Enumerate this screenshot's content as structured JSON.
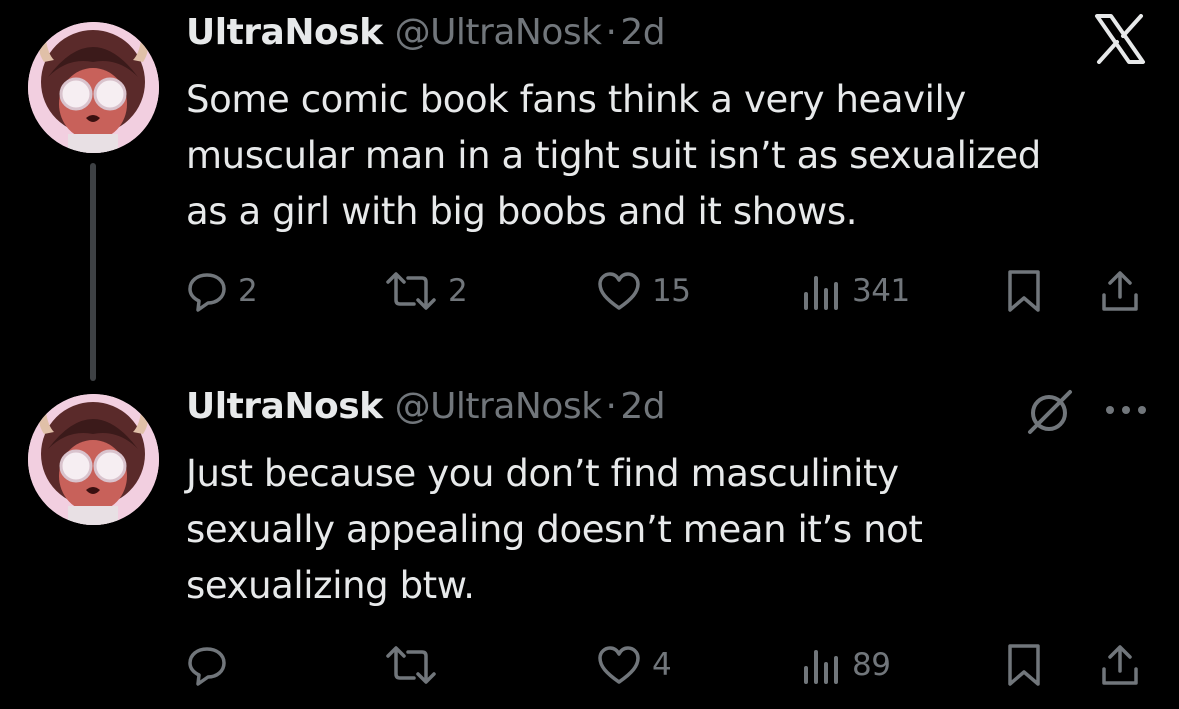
{
  "tweets": [
    {
      "name": "UltraNosk",
      "handle": "@UltraNosk",
      "separator": "·",
      "time": "2d",
      "text_lines": [
        "Some comic book fans think a very heavily",
        "muscular man in a tight suit isn’t as sexualized",
        "as a girl with big boobs and it shows."
      ],
      "replies": "2",
      "reposts": "2",
      "likes": "15",
      "views": "341",
      "corner_icon": "x-logo-icon"
    },
    {
      "name": "UltraNosk",
      "handle": "@UltraNosk",
      "separator": "·",
      "time": "2d",
      "text_lines": [
        "Just because you don’t find masculinity",
        "sexually appealing doesn’t mean it’s not",
        "sexualizing btw."
      ],
      "replies": "",
      "reposts": "",
      "likes": "4",
      "views": "89",
      "corner_icon": "grok-icon"
    }
  ],
  "colors": {
    "background": "#000000",
    "primary_text": "#e7e9ea",
    "secondary_text": "#71767b",
    "thread_line": "#3e4144"
  }
}
